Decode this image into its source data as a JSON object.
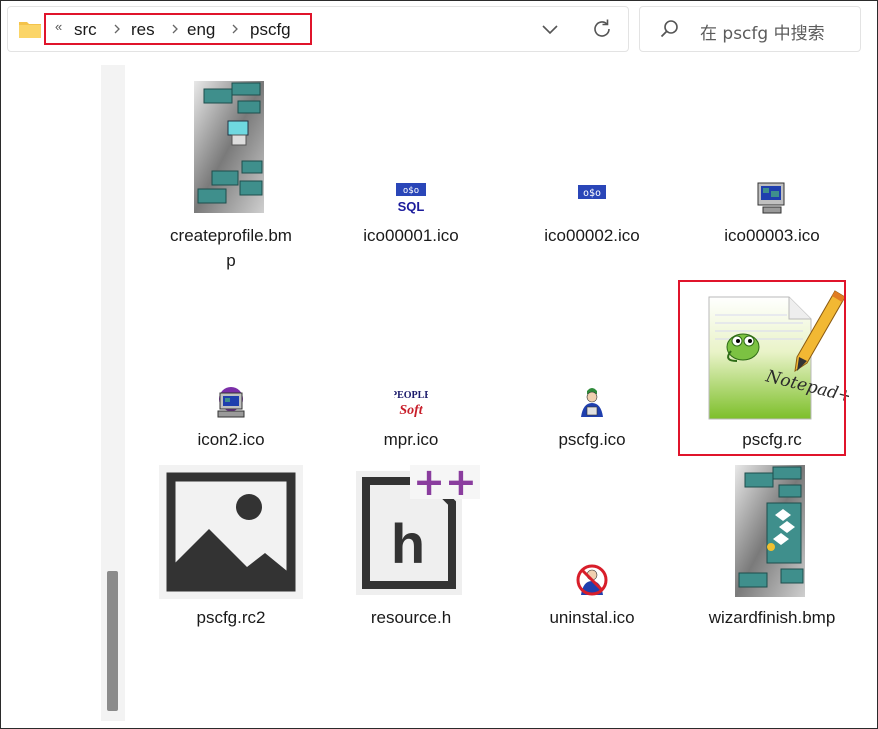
{
  "address_bar": {
    "more": "«",
    "crumbs": [
      "src",
      "res",
      "eng",
      "pscfg"
    ]
  },
  "search": {
    "placeholder": "在 pscfg 中搜索"
  },
  "files": [
    {
      "name1": "createprofile.bm",
      "name2": "p",
      "kind": "bmp-dialog"
    },
    {
      "name": "ico00001.ico",
      "kind": "ico-sql"
    },
    {
      "name": "ico00002.ico",
      "kind": "ico-db"
    },
    {
      "name": "ico00003.ico",
      "kind": "ico-monitor"
    },
    {
      "name": "icon2.ico",
      "kind": "ico-computer"
    },
    {
      "name": "mpr.ico",
      "kind": "ico-peoplesoft"
    },
    {
      "name": "pscfg.ico",
      "kind": "ico-person"
    },
    {
      "name": "pscfg.rc",
      "kind": "notepad++-file",
      "selected": true,
      "logo_text": "Notepad++"
    },
    {
      "name": "pscfg.rc2",
      "kind": "image-placeholder"
    },
    {
      "name": "resource.h",
      "kind": "header-file",
      "badge": "++",
      "letter": "h"
    },
    {
      "name": "uninstal.ico",
      "kind": "ico-no-person"
    },
    {
      "name": "wizardfinish.bmp",
      "kind": "bmp-wizard"
    }
  ],
  "colors": {
    "highlight": "#e0142b",
    "teal": "#3f8f8c",
    "purple": "#8a3d9e"
  }
}
